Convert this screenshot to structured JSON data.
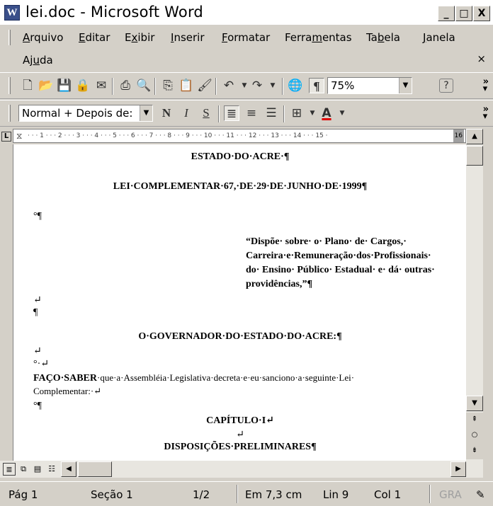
{
  "window": {
    "title": "lei.doc - Microsoft Word",
    "app_icon": "W",
    "controls": [
      "_",
      "□",
      "X"
    ]
  },
  "menu": {
    "items": [
      {
        "pre": "",
        "u": "A",
        "post": "rquivo"
      },
      {
        "pre": "",
        "u": "E",
        "post": "ditar"
      },
      {
        "pre": "E",
        "u": "x",
        "post": "ibir"
      },
      {
        "pre": "",
        "u": "I",
        "post": "nserir"
      },
      {
        "pre": "",
        "u": "F",
        "post": "ormatar"
      },
      {
        "pre": "Ferra",
        "u": "m",
        "post": "entas"
      },
      {
        "pre": "Ta",
        "u": "b",
        "post": "ela"
      },
      {
        "pre": "",
        "u": "J",
        "post": "anela"
      },
      {
        "pre": "Aj",
        "u": "u",
        "post": "da"
      }
    ],
    "close_doc": "×"
  },
  "standard_toolbar": {
    "zoom": "75%",
    "show_marks": "¶",
    "help": "?",
    "icons": [
      "new-doc-icon",
      "open-icon",
      "save-icon",
      "permission-icon",
      "email-icon",
      "print-icon",
      "print-preview-icon",
      "copy-icon",
      "paste-icon",
      "format-painter-icon",
      "undo-icon",
      "redo-icon",
      "insert-hyperlink-icon"
    ]
  },
  "format_toolbar": {
    "style": "Normal + Depois de:",
    "bold": "N",
    "italic": "I",
    "underline": "S",
    "font_color_letter": "A"
  },
  "ruler": {
    "text": "· · · 1 · · · 2 · · · 3 · · · 4 · · · 5 · · · 6 · · · 7 · · · 8 · · · 9 · · · 10 · · · 11 · · · 12 · · · 13 · · · 14 · · · 15 ·",
    "end_marker": "16"
  },
  "document": {
    "line1": "ESTADO·DO·ACRE·¶",
    "line2": "LEI·COMPLEMENTAR·67,·DE·29·DE·JUNHO·DE·1999¶",
    "line3": "°¶",
    "ementa": [
      "“Dispõe·  sobre·  o·  Plano·  de·  Cargos,·",
      "Carreira·e·Remuneração·dos·Profissionais·",
      "do·  Ensino·  Público·  Estadual·  e·  dá·  outras·",
      "providências,”¶"
    ],
    "line_break1": "↵",
    "line_pilcrow": "¶",
    "governador": "O·GOVERNADOR·DO·ESTADO·DO·ACRE:¶",
    "line_break2": "↵",
    "degree_break": "°·↵",
    "faco_bold": "FAÇO·SABER",
    "faco_rest": "·que·a·Assembléia·Legislativa·decreta·e·eu·sanciono·a·seguinte·Lei·",
    "complementar": "Complementar:·↵",
    "degree_pilcrow": "°¶",
    "capitulo": "CAPÍTULO·I↵",
    "line_break3": "↵",
    "disposicoes": "DISPOSIÇÕES·PRELIMINARES¶"
  },
  "status": {
    "page": "Pág 1",
    "section": "Seção 1",
    "pages": "1/2",
    "position": "Em 7,3 cm",
    "line": "Lin 9",
    "col": "Col 1",
    "rec": "GRA"
  }
}
